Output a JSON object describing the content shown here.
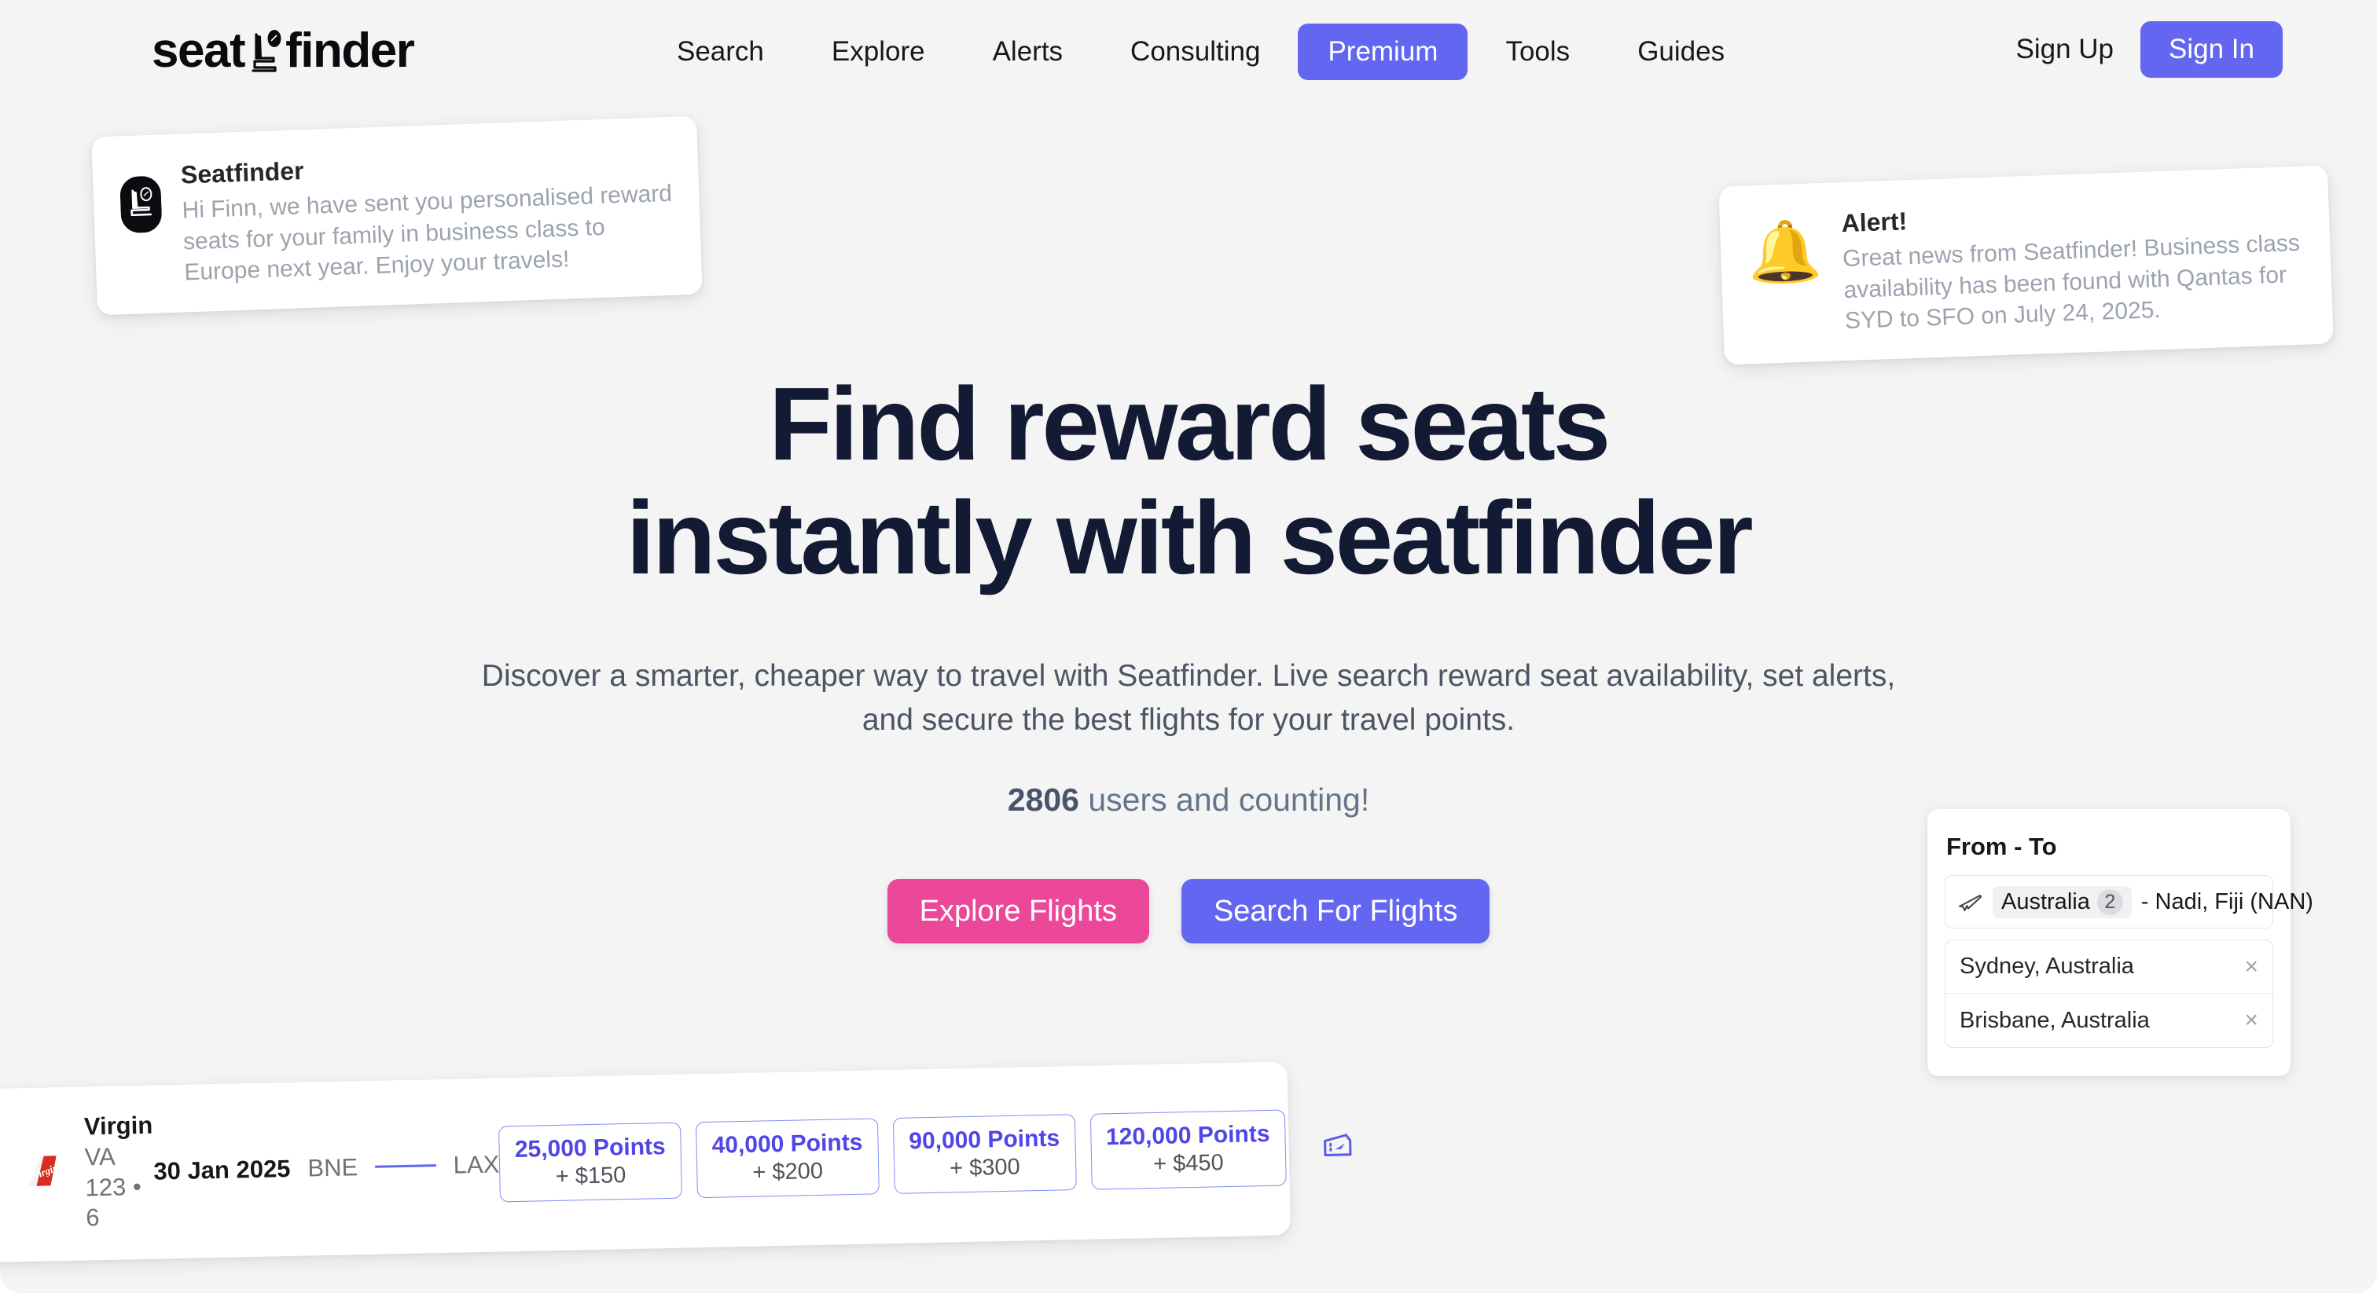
{
  "brand": {
    "name_part1": "seat",
    "name_part2": "finder",
    "logo_icon": "airplane-seat-icon",
    "accent_indigo": "#6366f1",
    "accent_pink": "#ec4899",
    "heading_color": "#131a33",
    "page_bg": "#f4f4f5"
  },
  "nav": {
    "items": [
      {
        "label": "Search",
        "active": false
      },
      {
        "label": "Explore",
        "active": false
      },
      {
        "label": "Alerts",
        "active": false
      },
      {
        "label": "Consulting",
        "active": false
      },
      {
        "label": "Premium",
        "active": true
      },
      {
        "label": "Tools",
        "active": false
      },
      {
        "label": "Guides",
        "active": false
      }
    ],
    "sign_up": "Sign Up",
    "sign_in": "Sign In"
  },
  "toast_left": {
    "icon": "seatfinder-avatar-icon",
    "title": "Seatfinder",
    "message": "Hi Finn, we have sent you personalised reward seats for your family in business class to Europe next year. Enjoy your travels!"
  },
  "toast_right": {
    "icon": "bell-emoji",
    "emoji": "🔔",
    "title": "Alert!",
    "message": "Great news from Seatfinder! Business class availability has been found with Qantas for SYD to SFO on July 24, 2025."
  },
  "hero": {
    "title_line1": "Find reward seats",
    "title_line2": "instantly with seatfinder",
    "subtitle": "Discover a smarter, cheaper way to travel with Seatfinder. Live search reward seat availability, set alerts, and secure the best flights for your travel points.",
    "user_count": "2806",
    "user_count_suffix": " users and counting!",
    "cta_primary": "Explore Flights",
    "cta_secondary": "Search For Flights"
  },
  "from_to": {
    "title": "From - To",
    "origin_chip": "Australia",
    "origin_count": "2",
    "separator": "- ",
    "destination": "Nadi, Fiji (NAN)",
    "selected": [
      {
        "label": "Sydney, Australia",
        "remove": "×"
      },
      {
        "label": "Brisbane, Australia",
        "remove": "×"
      }
    ]
  },
  "flight_card": {
    "airline": "Virgin",
    "airline_logo": "virgin-tailfin-icon",
    "flight_number": "VA 123 • 6",
    "date": "30 Jan 2025",
    "origin": "BNE",
    "destination": "LAX",
    "ticket_icon": "boarding-pass-icon",
    "fares": [
      {
        "points": "25,000 Points",
        "cash": "+ $150"
      },
      {
        "points": "40,000 Points",
        "cash": "+ $200"
      },
      {
        "points": "90,000 Points",
        "cash": "+ $300"
      },
      {
        "points": "120,000 Points",
        "cash": "+ $450"
      }
    ]
  }
}
